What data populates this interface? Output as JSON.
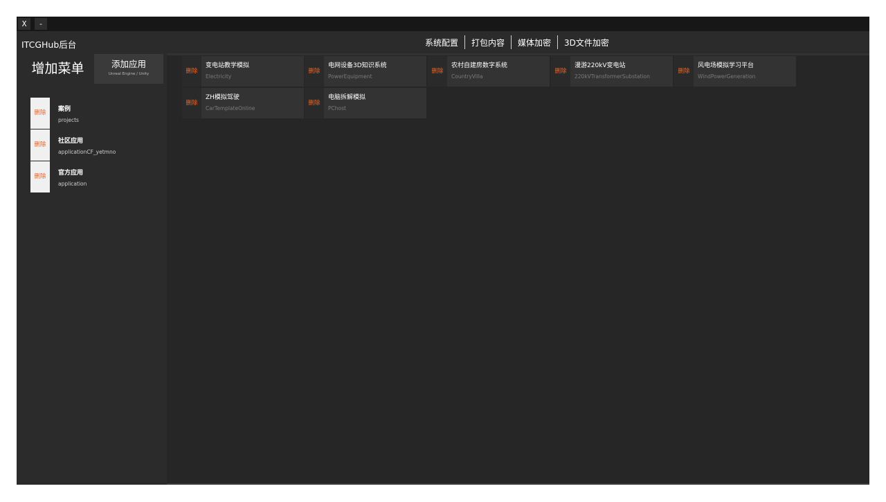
{
  "window": {
    "close_label": "X",
    "minimize_label": "-"
  },
  "sidebar": {
    "app_title": "ITCGHub后台",
    "add_menu_label": "增加菜单",
    "add_app_label": "添加应用",
    "add_app_sub": "Unreal Engine / Unity",
    "menu_items": [
      {
        "delete_label": "删除",
        "name": "案例",
        "key": "projects"
      },
      {
        "delete_label": "删除",
        "name": "社区应用",
        "key": "applicationCF_yetmno"
      },
      {
        "delete_label": "删除",
        "name": "官方应用",
        "key": "application"
      }
    ]
  },
  "topnav": {
    "items": [
      "系统配置",
      "打包内容",
      "媒体加密",
      "3D文件加密"
    ]
  },
  "apps": [
    {
      "delete_label": "删除",
      "name": "变电站教学模拟",
      "key": "Electricity"
    },
    {
      "delete_label": "删除",
      "name": "电网设备3D知识系统",
      "key": "PowerEquipment"
    },
    {
      "delete_label": "删除",
      "name": "农村自建房数字系统",
      "key": "CountryVilla"
    },
    {
      "delete_label": "删除",
      "name": "漫游220kV变电站",
      "key": "220kVTransformerSubstation"
    },
    {
      "delete_label": "删除",
      "name": "风电场模拟学习平台",
      "key": "WindPowerGeneration"
    },
    {
      "delete_label": "删除",
      "name": "ZH模拟驾驶",
      "key": "CarTemplateOnline"
    },
    {
      "delete_label": "删除",
      "name": "电脑拆解模拟",
      "key": "PChost"
    }
  ],
  "colors": {
    "accent_delete": "#e5662a",
    "background": "#262626",
    "panel": "#2b2b2b",
    "card": "#333333"
  }
}
